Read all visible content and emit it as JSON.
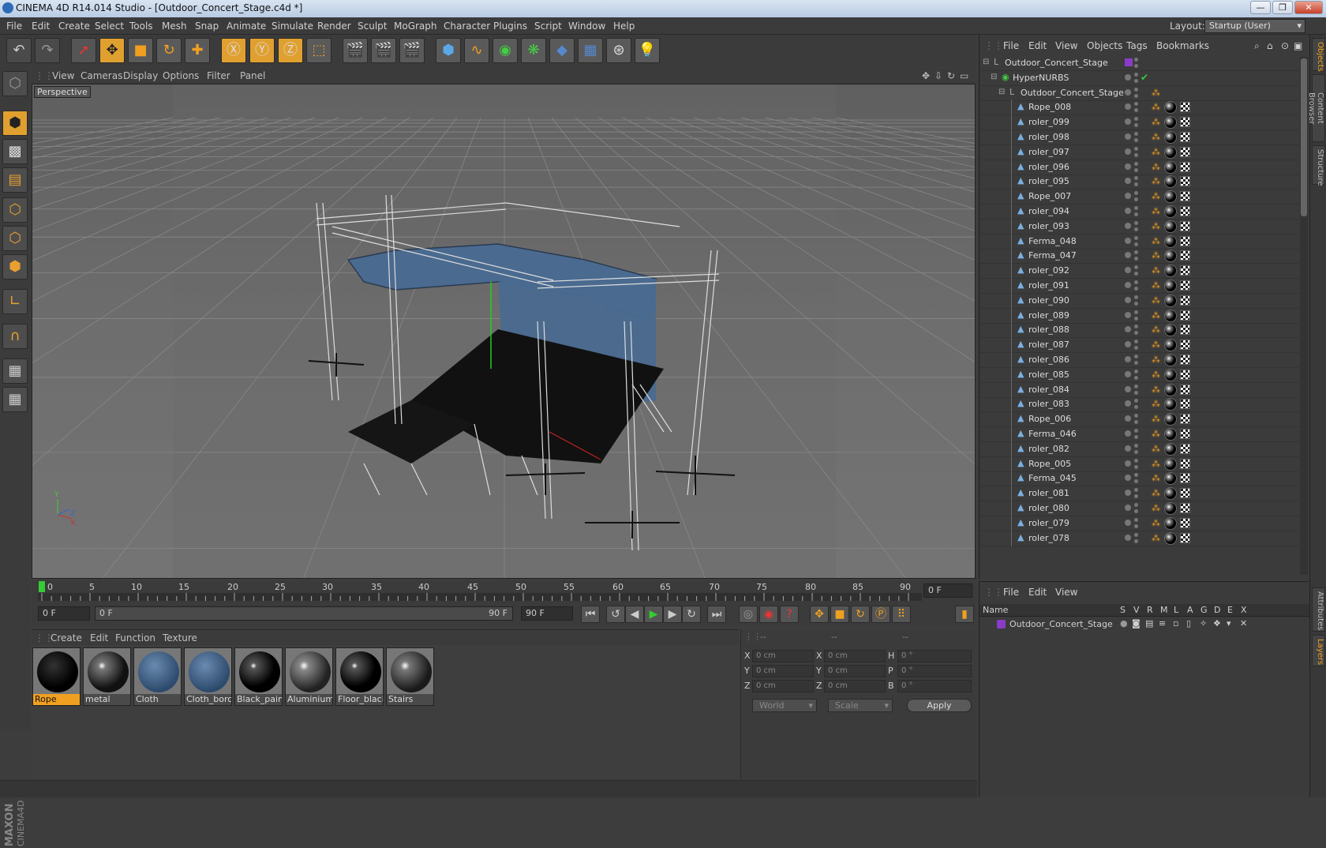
{
  "window": {
    "title": "CINEMA 4D R14.014 Studio - [Outdoor_Concert_Stage.c4d *]",
    "min": "—",
    "max": "❐",
    "close": "✕"
  },
  "menubar": {
    "items": [
      "File",
      "Edit",
      "Create",
      "Select",
      "Tools",
      "Mesh",
      "Snap",
      "Animate",
      "Simulate",
      "Render",
      "Sculpt",
      "MoGraph",
      "Character",
      "Plugins",
      "Script",
      "Window",
      "Help"
    ],
    "layout_label": "Layout:",
    "layout_value": "Startup (User)"
  },
  "viewport": {
    "menu": [
      "View",
      "Cameras",
      "Display",
      "Options",
      "Filter",
      "Panel"
    ],
    "label": "Perspective"
  },
  "timeline": {
    "ticks": [
      "0",
      "5",
      "10",
      "15",
      "20",
      "25",
      "30",
      "35",
      "40",
      "45",
      "50",
      "55",
      "60",
      "65",
      "70",
      "75",
      "80",
      "85",
      "90"
    ],
    "current_frame": "0 F"
  },
  "playbar": {
    "start_frame": "0 F",
    "range_start": "0 F",
    "range_end": "90 F",
    "end_frame": "90 F"
  },
  "materials": {
    "menu": [
      "Create",
      "Edit",
      "Function",
      "Texture"
    ],
    "items": [
      {
        "name": "Rope",
        "selected": true
      },
      {
        "name": "metal"
      },
      {
        "name": "Cloth"
      },
      {
        "name": "Cloth_borc"
      },
      {
        "name": "Black_pain"
      },
      {
        "name": "Aluminium"
      },
      {
        "name": "Floor_black"
      },
      {
        "name": "Stairs"
      }
    ]
  },
  "coords": {
    "header": [
      "--",
      "--",
      "--"
    ],
    "rows": [
      {
        "a": "X",
        "av": "0 cm",
        "b": "X",
        "bv": "0 cm",
        "c": "H",
        "cv": "0 °"
      },
      {
        "a": "Y",
        "av": "0 cm",
        "b": "Y",
        "bv": "0 cm",
        "c": "P",
        "cv": "0 °"
      },
      {
        "a": "Z",
        "av": "0 cm",
        "b": "Z",
        "bv": "0 cm",
        "c": "B",
        "cv": "0 °"
      }
    ],
    "space": "World",
    "mode": "Scale",
    "apply": "Apply"
  },
  "objects": {
    "menu": [
      "File",
      "Edit",
      "View",
      "Objects",
      "Tags",
      "Bookmarks"
    ],
    "items": [
      {
        "name": "Outdoor_Concert_Stage",
        "level": 0,
        "kind": "null"
      },
      {
        "name": "HyperNURBS",
        "level": 1,
        "kind": "nurbs"
      },
      {
        "name": "Outdoor_Concert_Stage",
        "level": 2,
        "kind": "null"
      },
      {
        "name": "Rope_008",
        "level": 3,
        "kind": "mesh"
      },
      {
        "name": "roler_099",
        "level": 3,
        "kind": "mesh"
      },
      {
        "name": "roler_098",
        "level": 3,
        "kind": "mesh"
      },
      {
        "name": "roler_097",
        "level": 3,
        "kind": "mesh"
      },
      {
        "name": "roler_096",
        "level": 3,
        "kind": "mesh"
      },
      {
        "name": "roler_095",
        "level": 3,
        "kind": "mesh"
      },
      {
        "name": "Rope_007",
        "level": 3,
        "kind": "mesh"
      },
      {
        "name": "roler_094",
        "level": 3,
        "kind": "mesh"
      },
      {
        "name": "roler_093",
        "level": 3,
        "kind": "mesh"
      },
      {
        "name": "Ferma_048",
        "level": 3,
        "kind": "mesh"
      },
      {
        "name": "Ferma_047",
        "level": 3,
        "kind": "mesh"
      },
      {
        "name": "roler_092",
        "level": 3,
        "kind": "mesh"
      },
      {
        "name": "roler_091",
        "level": 3,
        "kind": "mesh"
      },
      {
        "name": "roler_090",
        "level": 3,
        "kind": "mesh"
      },
      {
        "name": "roler_089",
        "level": 3,
        "kind": "mesh"
      },
      {
        "name": "roler_088",
        "level": 3,
        "kind": "mesh"
      },
      {
        "name": "roler_087",
        "level": 3,
        "kind": "mesh"
      },
      {
        "name": "roler_086",
        "level": 3,
        "kind": "mesh"
      },
      {
        "name": "roler_085",
        "level": 3,
        "kind": "mesh"
      },
      {
        "name": "roler_084",
        "level": 3,
        "kind": "mesh"
      },
      {
        "name": "roler_083",
        "level": 3,
        "kind": "mesh"
      },
      {
        "name": "Rope_006",
        "level": 3,
        "kind": "mesh"
      },
      {
        "name": "Ferma_046",
        "level": 3,
        "kind": "mesh"
      },
      {
        "name": "roler_082",
        "level": 3,
        "kind": "mesh"
      },
      {
        "name": "Rope_005",
        "level": 3,
        "kind": "mesh"
      },
      {
        "name": "Ferma_045",
        "level": 3,
        "kind": "mesh"
      },
      {
        "name": "roler_081",
        "level": 3,
        "kind": "mesh"
      },
      {
        "name": "roler_080",
        "level": 3,
        "kind": "mesh"
      },
      {
        "name": "roler_079",
        "level": 3,
        "kind": "mesh"
      },
      {
        "name": "roler_078",
        "level": 3,
        "kind": "mesh"
      }
    ]
  },
  "layers": {
    "menu": [
      "File",
      "Edit",
      "View"
    ],
    "columns": [
      "Name",
      "S",
      "V",
      "R",
      "M",
      "L",
      "A",
      "G",
      "D",
      "E",
      "X"
    ],
    "items": [
      {
        "name": "Outdoor_Concert_Stage",
        "color": "#8a3cc8"
      }
    ]
  },
  "right_tabs": [
    "Objects",
    "Content Browser",
    "Structure",
    "Attributes",
    "Layers"
  ],
  "colors": {
    "accent": "#f0a020",
    "panel": "#3b3b3b",
    "viewport_bg": "#6b6b6b",
    "stage_blue": "#4a6a90"
  }
}
